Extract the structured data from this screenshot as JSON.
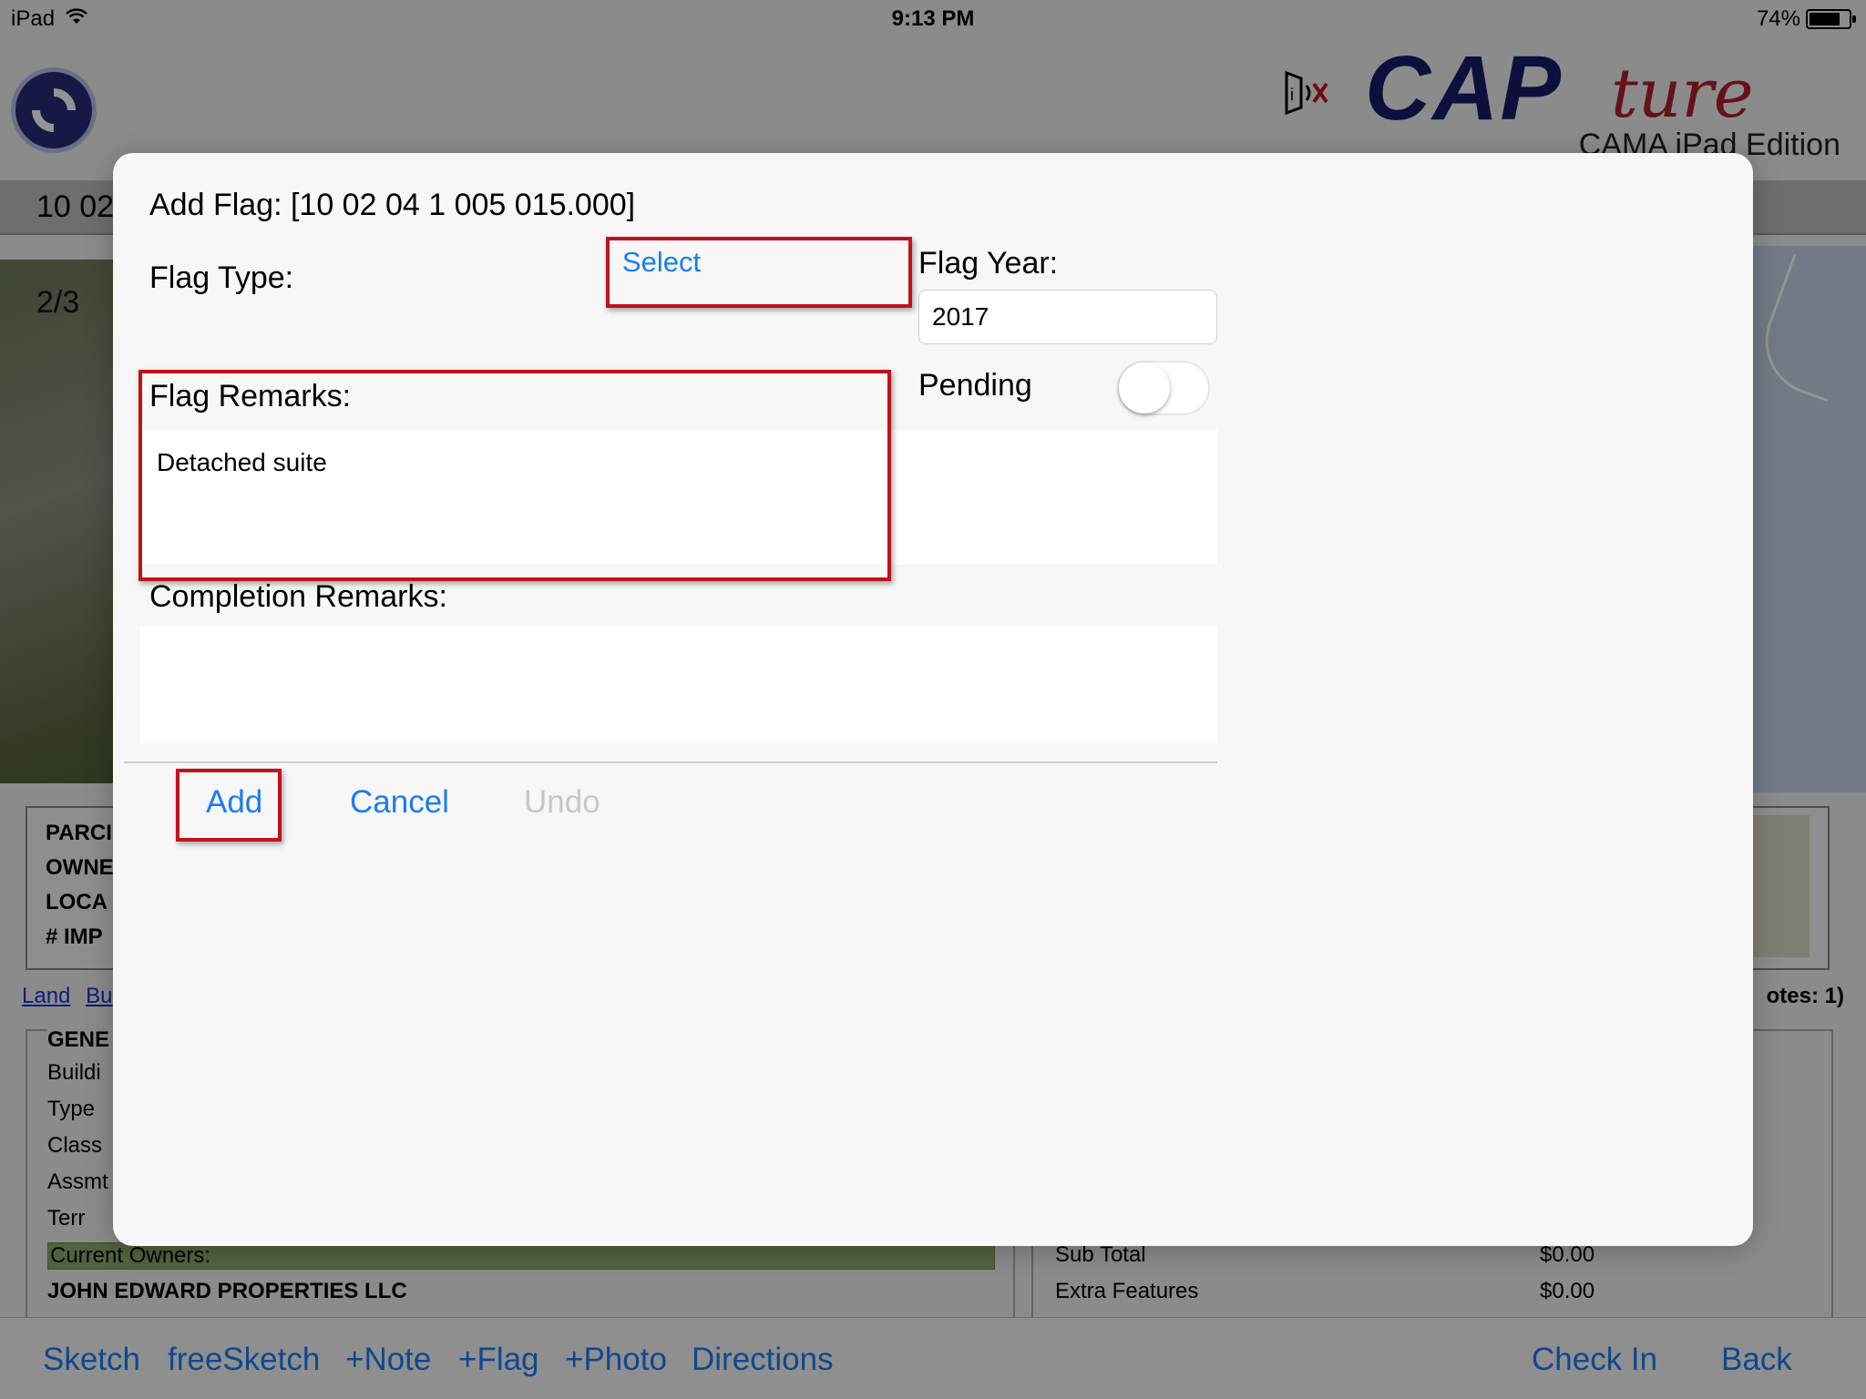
{
  "status_bar": {
    "carrier": "iPad",
    "time": "9:13 PM",
    "battery": "74%"
  },
  "brand": {
    "cap": "CAP",
    "ture": "ture",
    "subtitle": "CAMA iPad Edition"
  },
  "parcel_bar": {
    "text": "10 02"
  },
  "photo": {
    "counter": "2/3"
  },
  "parcel_info": {
    "labels": [
      "PARCI",
      "OWNE",
      "LOCA",
      "# IMP"
    ]
  },
  "links": {
    "items": [
      "Land",
      "Bu"
    ],
    "notes": "otes: 1)"
  },
  "general": {
    "title": "GENE",
    "fields": [
      "Buildi",
      "Type",
      "Class",
      "Assmt",
      "Terr"
    ],
    "current_owners_label": "Current Owners:",
    "owner_name": "JOHN EDWARD PROPERTIES LLC"
  },
  "values": {
    "rows": [
      {
        "label": "Sub Total",
        "amount": "$0.00"
      },
      {
        "label": "Extra Features",
        "amount": "$0.00"
      }
    ]
  },
  "toolbar": {
    "left": [
      "Sketch",
      "freeSketch",
      "+Note",
      "+Flag",
      "+Photo",
      "Directions"
    ],
    "check_in": "Check In",
    "back": "Back"
  },
  "modal": {
    "title": "Add Flag: [10 02 04 1 005 015.000]",
    "flag_type_label": "Flag Type:",
    "select_label": "Select",
    "flag_year_label": "Flag Year:",
    "flag_year_value": "2017",
    "pending_label": "Pending",
    "pending_on": false,
    "flag_remarks_label": "Flag Remarks:",
    "flag_remarks_value": "Detached suite",
    "completion_remarks_label": "Completion Remarks:",
    "completion_remarks_value": "",
    "add_label": "Add",
    "cancel_label": "Cancel",
    "undo_label": "Undo"
  },
  "colors": {
    "accent": "#1a7cf5",
    "highlight": "#c1121c",
    "brand_navy": "#1b1b6a",
    "brand_red": "#b0202a"
  }
}
